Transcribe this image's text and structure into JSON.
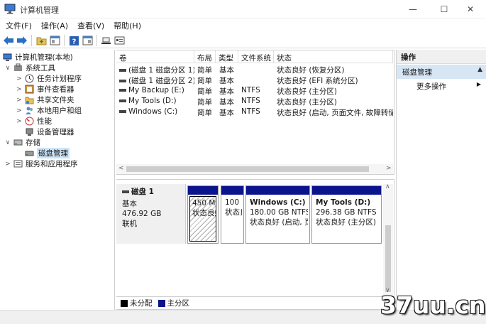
{
  "window": {
    "title": "计算机管理",
    "controls": {
      "minimize": "—",
      "maximize": "☐",
      "close": "✕"
    }
  },
  "menu": [
    "文件(F)",
    "操作(A)",
    "查看(V)",
    "帮助(H)"
  ],
  "toolbar": {
    "icons": [
      "back-icon",
      "forward-icon",
      "up-folder-icon",
      "show-tree-icon",
      "help-icon",
      "show-pane-icon",
      "connect-icon",
      "properties-icon"
    ]
  },
  "tree": {
    "root": "计算机管理(本地)",
    "system_tools": "系统工具",
    "task_scheduler": "任务计划程序",
    "event_viewer": "事件查看器",
    "shared_folders": "共享文件夹",
    "local_users": "本地用户和组",
    "performance": "性能",
    "device_manager": "设备管理器",
    "storage": "存储",
    "disk_management": "磁盘管理",
    "services_apps": "服务和应用程序"
  },
  "volumes": {
    "columns": [
      "卷",
      "布局",
      "类型",
      "文件系统",
      "状态"
    ],
    "rows": [
      {
        "name": "(磁盘 1 磁盘分区 1)",
        "layout": "简单",
        "type": "基本",
        "fs": "",
        "status": "状态良好 (恢复分区)"
      },
      {
        "name": "(磁盘 1 磁盘分区 2)",
        "layout": "简单",
        "type": "基本",
        "fs": "",
        "status": "状态良好 (EFI 系统分区)"
      },
      {
        "name": "My Backup (E:)",
        "layout": "简单",
        "type": "基本",
        "fs": "NTFS",
        "status": "状态良好 (主分区)"
      },
      {
        "name": "My Tools (D:)",
        "layout": "简单",
        "type": "基本",
        "fs": "NTFS",
        "status": "状态良好 (主分区)"
      },
      {
        "name": "Windows (C:)",
        "layout": "简单",
        "type": "基本",
        "fs": "NTFS",
        "status": "状态良好 (启动, 页面文件, 故障转储,"
      }
    ]
  },
  "disk": {
    "name": "磁盘 1",
    "type": "基本",
    "size": "476.92 GB",
    "status": "联机",
    "partitions": [
      {
        "label": "",
        "size": "450 MI",
        "status": "状态良好"
      },
      {
        "label": "",
        "size": "100",
        "status": "状态良"
      },
      {
        "label": "Windows  (C:)",
        "size": "180.00 GB NTFS",
        "status": "状态良好 (启动, 页"
      },
      {
        "label": "My Tools  (D:)",
        "size": "296.38 GB NTFS",
        "status": "状态良好 (主分区)"
      }
    ]
  },
  "legend": {
    "unallocated": "未分配",
    "primary": "主分区",
    "unallocated_color": "#000000",
    "primary_color": "#0a148c"
  },
  "actions": {
    "header": "操作",
    "section": "磁盘管理",
    "more": "更多操作"
  },
  "watermark": "37uu.cn"
}
